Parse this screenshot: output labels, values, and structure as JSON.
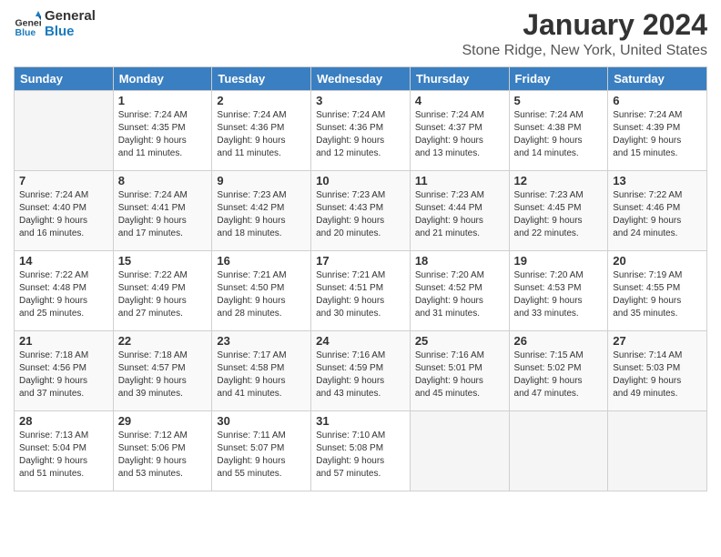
{
  "header": {
    "logo_general": "General",
    "logo_blue": "Blue",
    "title": "January 2024",
    "location": "Stone Ridge, New York, United States"
  },
  "weekdays": [
    "Sunday",
    "Monday",
    "Tuesday",
    "Wednesday",
    "Thursday",
    "Friday",
    "Saturday"
  ],
  "weeks": [
    [
      {
        "day": "",
        "info": ""
      },
      {
        "day": "1",
        "info": "Sunrise: 7:24 AM\nSunset: 4:35 PM\nDaylight: 9 hours\nand 11 minutes."
      },
      {
        "day": "2",
        "info": "Sunrise: 7:24 AM\nSunset: 4:36 PM\nDaylight: 9 hours\nand 11 minutes."
      },
      {
        "day": "3",
        "info": "Sunrise: 7:24 AM\nSunset: 4:36 PM\nDaylight: 9 hours\nand 12 minutes."
      },
      {
        "day": "4",
        "info": "Sunrise: 7:24 AM\nSunset: 4:37 PM\nDaylight: 9 hours\nand 13 minutes."
      },
      {
        "day": "5",
        "info": "Sunrise: 7:24 AM\nSunset: 4:38 PM\nDaylight: 9 hours\nand 14 minutes."
      },
      {
        "day": "6",
        "info": "Sunrise: 7:24 AM\nSunset: 4:39 PM\nDaylight: 9 hours\nand 15 minutes."
      }
    ],
    [
      {
        "day": "7",
        "info": "Sunrise: 7:24 AM\nSunset: 4:40 PM\nDaylight: 9 hours\nand 16 minutes."
      },
      {
        "day": "8",
        "info": "Sunrise: 7:24 AM\nSunset: 4:41 PM\nDaylight: 9 hours\nand 17 minutes."
      },
      {
        "day": "9",
        "info": "Sunrise: 7:23 AM\nSunset: 4:42 PM\nDaylight: 9 hours\nand 18 minutes."
      },
      {
        "day": "10",
        "info": "Sunrise: 7:23 AM\nSunset: 4:43 PM\nDaylight: 9 hours\nand 20 minutes."
      },
      {
        "day": "11",
        "info": "Sunrise: 7:23 AM\nSunset: 4:44 PM\nDaylight: 9 hours\nand 21 minutes."
      },
      {
        "day": "12",
        "info": "Sunrise: 7:23 AM\nSunset: 4:45 PM\nDaylight: 9 hours\nand 22 minutes."
      },
      {
        "day": "13",
        "info": "Sunrise: 7:22 AM\nSunset: 4:46 PM\nDaylight: 9 hours\nand 24 minutes."
      }
    ],
    [
      {
        "day": "14",
        "info": "Sunrise: 7:22 AM\nSunset: 4:48 PM\nDaylight: 9 hours\nand 25 minutes."
      },
      {
        "day": "15",
        "info": "Sunrise: 7:22 AM\nSunset: 4:49 PM\nDaylight: 9 hours\nand 27 minutes."
      },
      {
        "day": "16",
        "info": "Sunrise: 7:21 AM\nSunset: 4:50 PM\nDaylight: 9 hours\nand 28 minutes."
      },
      {
        "day": "17",
        "info": "Sunrise: 7:21 AM\nSunset: 4:51 PM\nDaylight: 9 hours\nand 30 minutes."
      },
      {
        "day": "18",
        "info": "Sunrise: 7:20 AM\nSunset: 4:52 PM\nDaylight: 9 hours\nand 31 minutes."
      },
      {
        "day": "19",
        "info": "Sunrise: 7:20 AM\nSunset: 4:53 PM\nDaylight: 9 hours\nand 33 minutes."
      },
      {
        "day": "20",
        "info": "Sunrise: 7:19 AM\nSunset: 4:55 PM\nDaylight: 9 hours\nand 35 minutes."
      }
    ],
    [
      {
        "day": "21",
        "info": "Sunrise: 7:18 AM\nSunset: 4:56 PM\nDaylight: 9 hours\nand 37 minutes."
      },
      {
        "day": "22",
        "info": "Sunrise: 7:18 AM\nSunset: 4:57 PM\nDaylight: 9 hours\nand 39 minutes."
      },
      {
        "day": "23",
        "info": "Sunrise: 7:17 AM\nSunset: 4:58 PM\nDaylight: 9 hours\nand 41 minutes."
      },
      {
        "day": "24",
        "info": "Sunrise: 7:16 AM\nSunset: 4:59 PM\nDaylight: 9 hours\nand 43 minutes."
      },
      {
        "day": "25",
        "info": "Sunrise: 7:16 AM\nSunset: 5:01 PM\nDaylight: 9 hours\nand 45 minutes."
      },
      {
        "day": "26",
        "info": "Sunrise: 7:15 AM\nSunset: 5:02 PM\nDaylight: 9 hours\nand 47 minutes."
      },
      {
        "day": "27",
        "info": "Sunrise: 7:14 AM\nSunset: 5:03 PM\nDaylight: 9 hours\nand 49 minutes."
      }
    ],
    [
      {
        "day": "28",
        "info": "Sunrise: 7:13 AM\nSunset: 5:04 PM\nDaylight: 9 hours\nand 51 minutes."
      },
      {
        "day": "29",
        "info": "Sunrise: 7:12 AM\nSunset: 5:06 PM\nDaylight: 9 hours\nand 53 minutes."
      },
      {
        "day": "30",
        "info": "Sunrise: 7:11 AM\nSunset: 5:07 PM\nDaylight: 9 hours\nand 55 minutes."
      },
      {
        "day": "31",
        "info": "Sunrise: 7:10 AM\nSunset: 5:08 PM\nDaylight: 9 hours\nand 57 minutes."
      },
      {
        "day": "",
        "info": ""
      },
      {
        "day": "",
        "info": ""
      },
      {
        "day": "",
        "info": ""
      }
    ]
  ]
}
